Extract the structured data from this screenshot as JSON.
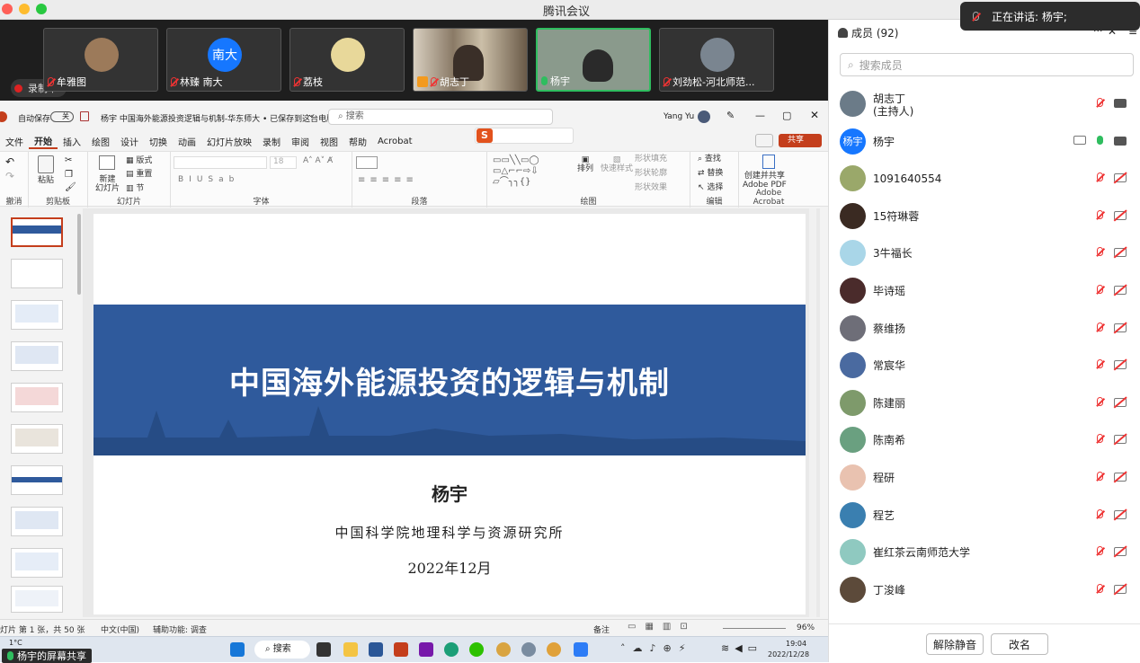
{
  "meeting": {
    "title": "腾讯会议",
    "speaking": "正在讲话: 杨宇;",
    "recording": "录制中",
    "share_label": "杨宇的屏幕共享"
  },
  "video_tiles": [
    {
      "name": "牟雅图",
      "muted": true
    },
    {
      "name": "林臻 南大",
      "avatar_text": "南大",
      "muted": true
    },
    {
      "name": "荔枝",
      "muted": true
    },
    {
      "name": "胡志丁",
      "muted": true
    },
    {
      "name": "杨宇",
      "muted": false,
      "active": true
    },
    {
      "name": "刘劲松-河北师范...",
      "muted": true
    }
  ],
  "ppt": {
    "autosave": "自动保存",
    "autosave_state": "关",
    "doc_title": "杨宇 中国海外能源投资逻辑与机制-华东师大 • 已保存到这台电脑",
    "search_placeholder": "搜索",
    "user": "Yang Yu",
    "share_button": "共享",
    "menu": [
      "文件",
      "开始",
      "插入",
      "绘图",
      "设计",
      "切换",
      "动画",
      "幻灯片放映",
      "录制",
      "审阅",
      "视图",
      "帮助",
      "Acrobat"
    ],
    "ribbon_groups": [
      "撤消",
      "剪贴板",
      "幻灯片",
      "字体",
      "段落",
      "绘图",
      "编辑",
      "Adobe Acrobat"
    ],
    "ribbon_buttons": {
      "paste": "粘贴",
      "new_slide": "新建\n幻灯片",
      "layout": "版式",
      "reset": "重置",
      "section": "节",
      "font_size": "18",
      "arrange": "排列",
      "quick_styles": "快速样式",
      "shape_fill": "形状填充",
      "shape_outline": "形状轮廓",
      "shape_effects": "形状效果",
      "find": "查找",
      "replace": "替换",
      "select": "选择",
      "create_pdf": "创建并共享\nAdobe PDF"
    },
    "slide": {
      "title": "中国海外能源投资的逻辑与机制",
      "author": "杨宇",
      "institution": "中国科学院地理科学与资源研究所",
      "date": "2022年12月"
    },
    "status": {
      "slide_info": "灯片 第 1 张，共 50 张",
      "language": "中文(中国)",
      "accessibility": "辅助功能: 调查",
      "notes": "备注",
      "zoom": "96%"
    }
  },
  "taskbar": {
    "temp": "1°C",
    "search": "搜索",
    "time": "19:04",
    "date": "2022/12/28"
  },
  "members_panel": {
    "title": "成员 (92)",
    "search_placeholder": "搜索成员",
    "unmute_button": "解除静音",
    "rename_button": "改名",
    "members": [
      {
        "name": "胡志丁",
        "role": "(主持人)",
        "mic": "off",
        "cam": "on",
        "avatar_color": "#6b7b88"
      },
      {
        "name": "杨宇",
        "avatar_text": "杨宇",
        "mic": "on",
        "cam": "on",
        "avatar_color": "#1677ff"
      },
      {
        "name": "1091640554",
        "mic": "off",
        "cam": "off",
        "avatar_color": "#9aa86a"
      },
      {
        "name": "15符琳蓉",
        "mic": "off",
        "cam": "off",
        "avatar_color": "#3a2a22"
      },
      {
        "name": "3牛福长",
        "mic": "off",
        "cam": "off",
        "avatar_color": "#a9d6e8"
      },
      {
        "name": "毕诗瑶",
        "mic": "off",
        "cam": "off",
        "avatar_color": "#4a2b2b"
      },
      {
        "name": "蔡维扬",
        "mic": "off",
        "cam": "off",
        "avatar_color": "#6e6e78"
      },
      {
        "name": "常宸华",
        "mic": "off",
        "cam": "off",
        "avatar_color": "#4a6aa0"
      },
      {
        "name": "陈建丽",
        "mic": "off",
        "cam": "off",
        "avatar_color": "#7e9a6b"
      },
      {
        "name": "陈南希",
        "mic": "off",
        "cam": "off",
        "avatar_color": "#6aa080"
      },
      {
        "name": "程研",
        "mic": "off",
        "cam": "off",
        "avatar_color": "#e9c2b0"
      },
      {
        "name": "程艺",
        "mic": "off",
        "cam": "off",
        "avatar_color": "#3a7fb0"
      },
      {
        "name": "崔红茶云南师范大学",
        "mic": "off",
        "cam": "off",
        "avatar_color": "#8fc9c0"
      },
      {
        "name": "丁浚峰",
        "mic": "off",
        "cam": "off",
        "avatar_color": "#5c4a3a"
      }
    ]
  },
  "colors": {
    "accent_red": "#c43e1c",
    "slide_blue": "#2f5a9c",
    "mic_green": "#2fbd5f",
    "mute_red": "#e33333"
  }
}
